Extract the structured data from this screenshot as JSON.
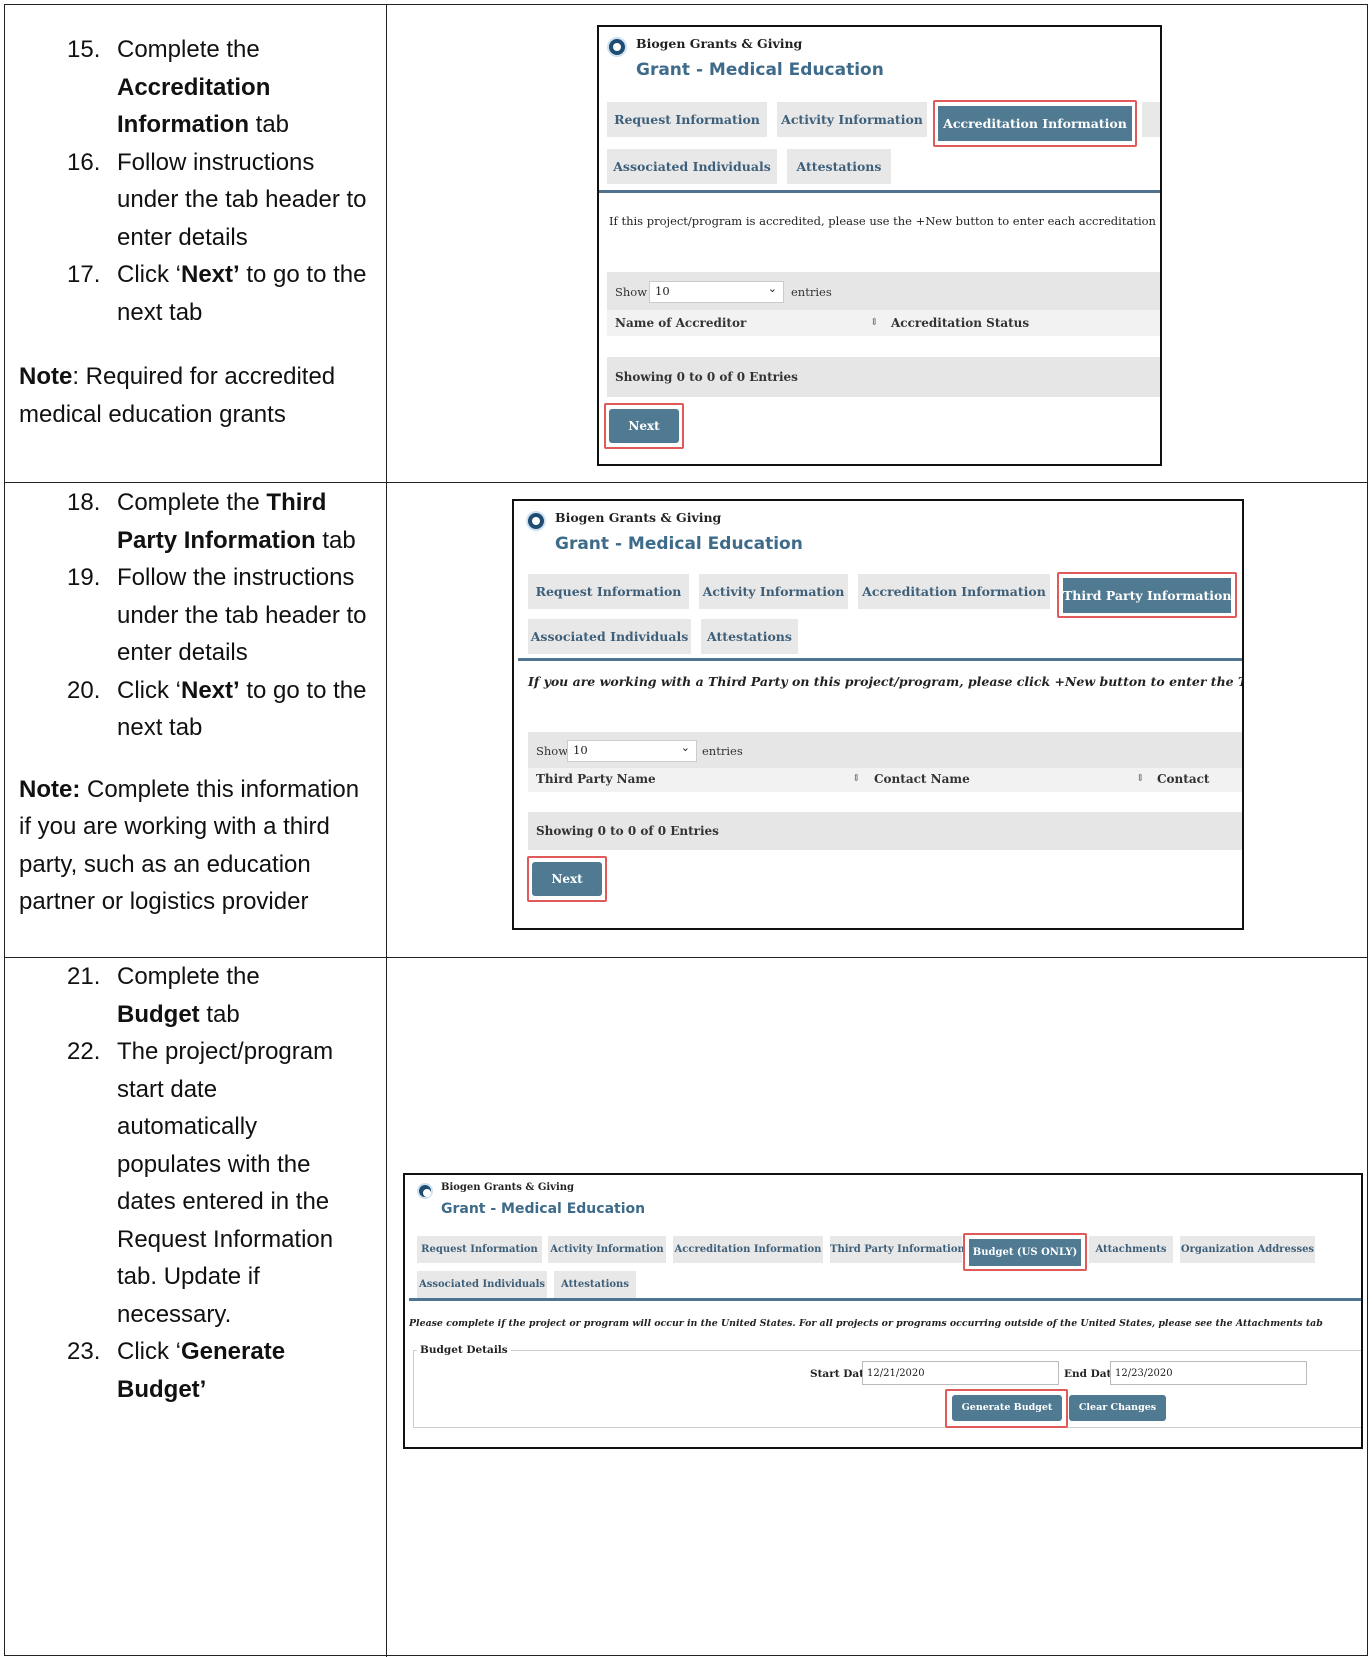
{
  "sections": [
    {
      "steps": [
        {
          "num": "15.",
          "text_before": "Complete the ",
          "bold": "Accreditation Information",
          "text_after": " tab"
        },
        {
          "num": "16.",
          "text_before": "Follow instructions under the tab header to enter details",
          "bold": "",
          "text_after": ""
        },
        {
          "num": "17.",
          "text_before": " Click ‘",
          "bold": "Next’",
          "text_after": " to go to the next tab"
        }
      ],
      "note_label": "Note",
      "note_text": ": Required for accredited medical education grants"
    },
    {
      "steps": [
        {
          "num": "18.",
          "text_before": "Complete the ",
          "bold": "Third Party Information",
          "text_after": " tab"
        },
        {
          "num": "19.",
          "text_before": "Follow the instructions under the tab header to enter details",
          "bold": "",
          "text_after": ""
        },
        {
          "num": "20.",
          "text_before": "Click ‘",
          "bold": "Next’",
          "text_after": " to go to the next tab"
        }
      ],
      "note_label": "Note:",
      "note_text": " Complete this information if you are working with a third party, such as an education partner or logistics provider"
    },
    {
      "steps": [
        {
          "num": "21.",
          "text_before": "Complete the ",
          "bold": "Budget",
          "text_after": " tab"
        },
        {
          "num": "22.",
          "text_before": "The project/program start date automatically populates with the dates entered in the Request Information tab. Update if necessary.",
          "bold": "",
          "text_after": ""
        },
        {
          "num": "23.",
          "text_before": "Click ‘",
          "bold": "Generate Budget’",
          "text_after": ""
        }
      ]
    }
  ],
  "shots": [
    {
      "org": "Biogen Grants & Giving",
      "title": "Grant - Medical Education",
      "tabs_row1": [
        "Request Information",
        "Activity Information",
        "Accreditation Information"
      ],
      "tabs_row2": [
        "Associated Individuals",
        "Attestations"
      ],
      "instruction": "If this project/program is accredited, please use the +New button to enter each accreditation type.",
      "show_label": "Show",
      "show_value": "10",
      "entries_label": "entries",
      "columns": [
        "Name of Accreditor",
        "Accreditation Status"
      ],
      "footer": "Showing 0 to 0 of 0 Entries",
      "next": "Next"
    },
    {
      "org": "Biogen Grants & Giving",
      "title": "Grant - Medical Education",
      "tabs_row1": [
        "Request Information",
        "Activity Information",
        "Accreditation Information",
        "Third Party Information"
      ],
      "tabs_row2": [
        "Associated Individuals",
        "Attestations"
      ],
      "instruction": "If you are working with a Third Party on this project/program, please click +New button to enter the Third Party info",
      "show_label": "Show",
      "show_value": "10",
      "entries_label": "entries",
      "columns": [
        "Third Party Name",
        "Contact Name",
        "Contact"
      ],
      "footer": "Showing 0 to 0 of 0 Entries",
      "next": "Next"
    },
    {
      "org": "Biogen Grants & Giving",
      "title": "Grant - Medical Education",
      "tabs_row1": [
        "Request Information",
        "Activity Information",
        "Accreditation Information",
        "Third Party Information",
        "Budget (US ONLY)",
        "Attachments",
        "Organization Addresses"
      ],
      "tabs_row2": [
        "Associated Individuals",
        "Attestations"
      ],
      "instruction": "Please complete if the project or program will occur in the United States. For all projects or programs occurring outside of the United States, please see the Attachments tab",
      "fieldset_legend": "Budget Details",
      "start_label": "Start Date:",
      "start_value": "12/21/2020",
      "end_label": "End Date:",
      "end_value": "12/23/2020",
      "generate": "Generate Budget",
      "clear": "Clear Changes"
    }
  ],
  "colors": {
    "accent": "#4f7a92",
    "highlight": "#e05a5a",
    "title": "#3e6b8a"
  }
}
